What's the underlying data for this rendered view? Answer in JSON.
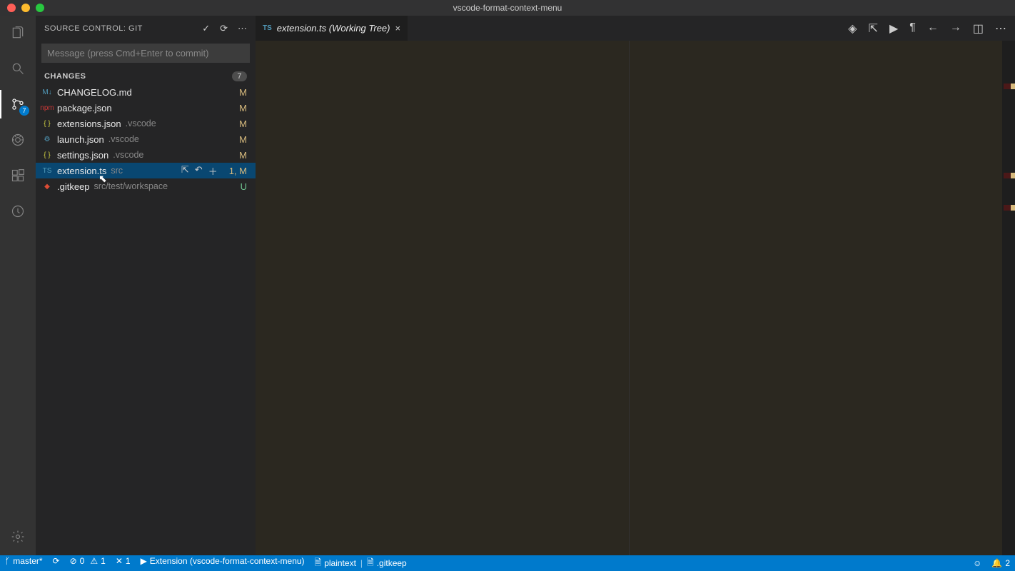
{
  "window": {
    "title": "vscode-format-context-menu"
  },
  "scm": {
    "header": "Source Control: Git",
    "commit_placeholder": "Message (press Cmd+Enter to commit)",
    "section": "CHANGES",
    "count": "7",
    "badge": "7",
    "files": [
      {
        "icon": "M↓",
        "iconColor": "#519aba",
        "name": "CHANGELOG.md",
        "path": "",
        "status": "M",
        "selected": false
      },
      {
        "icon": "npm",
        "iconColor": "#cb3837",
        "name": "package.json",
        "path": "",
        "status": "M",
        "selected": false
      },
      {
        "icon": "{ }",
        "iconColor": "#cbcb41",
        "name": "extensions.json",
        "path": ".vscode",
        "status": "M",
        "selected": false
      },
      {
        "icon": "⚙",
        "iconColor": "#519aba",
        "name": "launch.json",
        "path": ".vscode",
        "status": "M",
        "selected": false
      },
      {
        "icon": "{ }",
        "iconColor": "#cbcb41",
        "name": "settings.json",
        "path": ".vscode",
        "status": "M",
        "selected": false
      },
      {
        "icon": "TS",
        "iconColor": "#519aba",
        "name": "extension.ts",
        "path": "src",
        "status": "1, M",
        "selected": true,
        "actions": true
      },
      {
        "icon": "◆",
        "iconColor": "#dd4c35",
        "name": ".gitkeep",
        "path": "src/test/workspace",
        "status": "U",
        "selected": false
      }
    ]
  },
  "tab": {
    "label": "extension.ts (Working Tree)",
    "icon": "TS"
  },
  "status": {
    "branch": "master*",
    "errors": "0",
    "warnings": "1",
    "sync": "1",
    "launch": "Extension (vscode-format-context-menu)",
    "lang": "plaintext",
    "file": ".gitkeep",
    "notif": "2"
  }
}
